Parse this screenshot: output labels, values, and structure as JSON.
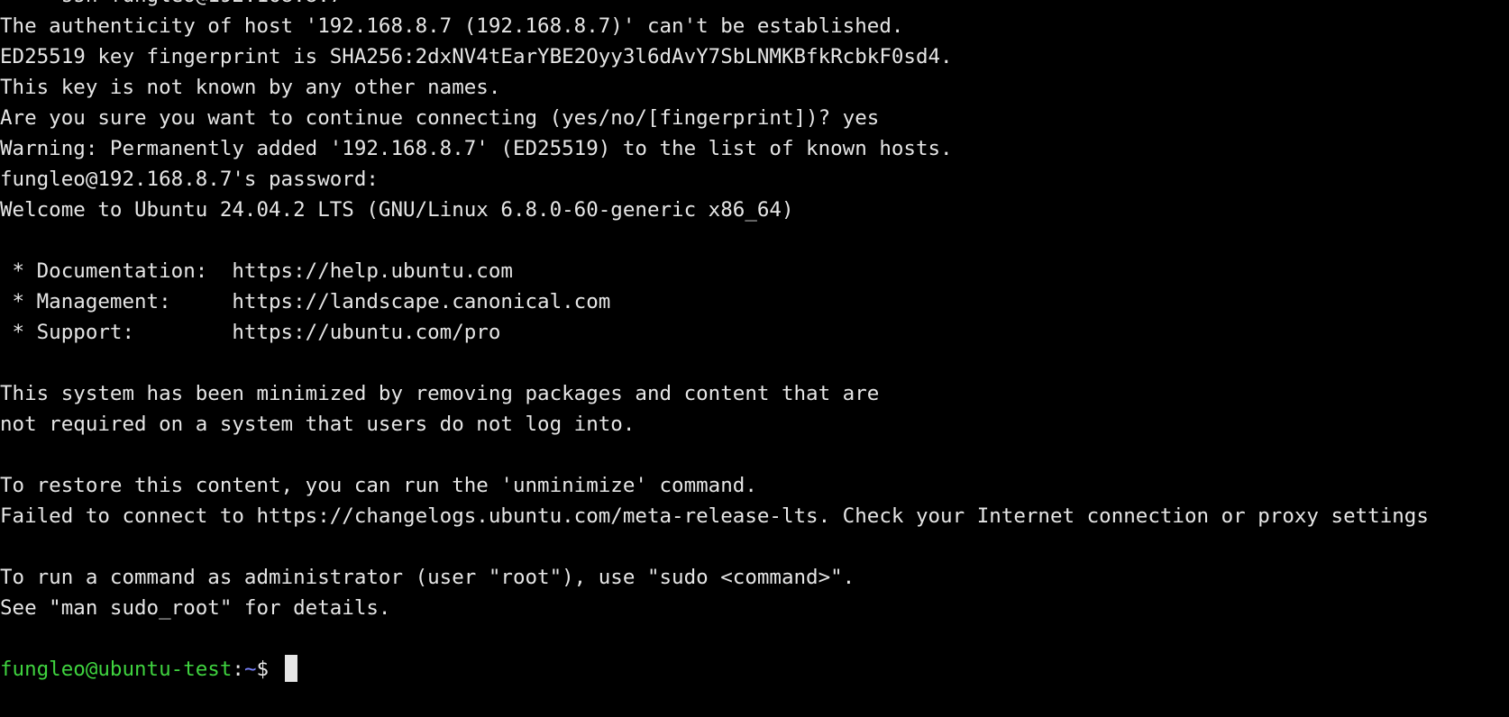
{
  "terminal": {
    "first_prompt": {
      "arrow": "➜",
      "dir": "~",
      "command": "ssh fungleo@192.168.8.7"
    },
    "output": [
      "The authenticity of host '192.168.8.7 (192.168.8.7)' can't be established.",
      "ED25519 key fingerprint is SHA256:2dxNV4tEarYBE2Oyy3l6dAvY7SbLNMKBfkRcbkF0sd4.",
      "This key is not known by any other names.",
      "Are you sure you want to continue connecting (yes/no/[fingerprint])? yes",
      "Warning: Permanently added '192.168.8.7' (ED25519) to the list of known hosts.",
      "fungleo@192.168.8.7's password:",
      "Welcome to Ubuntu 24.04.2 LTS (GNU/Linux 6.8.0-60-generic x86_64)",
      "",
      " * Documentation:  https://help.ubuntu.com",
      " * Management:     https://landscape.canonical.com",
      " * Support:        https://ubuntu.com/pro",
      "",
      "This system has been minimized by removing packages and content that are",
      "not required on a system that users do not log into.",
      "",
      "To restore this content, you can run the 'unminimize' command.",
      "Failed to connect to https://changelogs.ubuntu.com/meta-release-lts. Check your Internet connection or proxy settings",
      "",
      "To run a command as administrator (user \"root\"), use \"sudo <command>\".",
      "See \"man sudo_root\" for details.",
      ""
    ],
    "final_prompt": {
      "user_host": "fungleo@ubuntu-test",
      "separator": ":",
      "path": "~",
      "symbol": "$ "
    },
    "colors": {
      "background": "#000000",
      "text": "#e6e6e6",
      "arrow": "#e8453c",
      "tilde": "#2fc4d9",
      "user_host": "#3fd33f",
      "path": "#7b84ff"
    }
  }
}
